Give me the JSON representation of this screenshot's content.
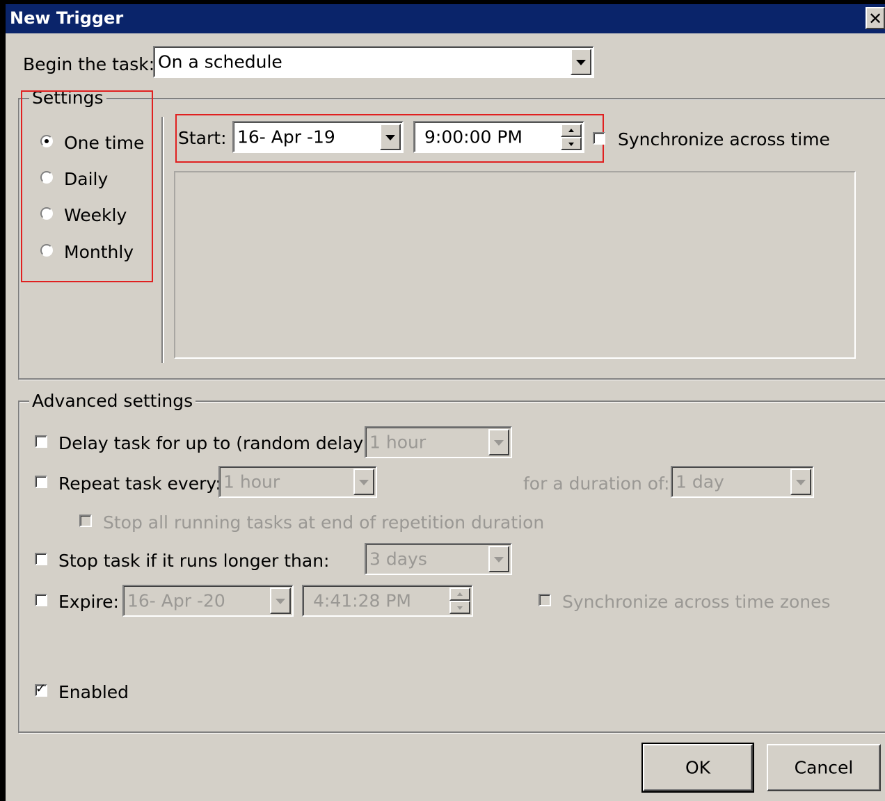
{
  "window": {
    "title": "New Trigger",
    "close_label": "✕"
  },
  "begin": {
    "label": "Begin the task:",
    "value": "On a schedule"
  },
  "settings": {
    "legend": "Settings",
    "options": [
      {
        "label": "One time",
        "selected": true
      },
      {
        "label": "Daily",
        "selected": false
      },
      {
        "label": "Weekly",
        "selected": false
      },
      {
        "label": "Monthly",
        "selected": false
      }
    ],
    "start_label": "Start:",
    "start_date": "16- Apr -19",
    "start_time": "9:00:00 PM",
    "sync_label": "Synchronize across time",
    "sync_checked": false
  },
  "advanced": {
    "legend": "Advanced settings",
    "delay": {
      "label": "Delay task for up to (random delay):",
      "value": "1 hour",
      "checked": false
    },
    "repeat": {
      "label": "Repeat task every:",
      "value": "1 hour",
      "checked": false,
      "duration_label": "for a duration of:",
      "duration_value": "1 day"
    },
    "stop_all": {
      "label": "Stop all running tasks at end of repetition duration",
      "checked": false
    },
    "stop_longer": {
      "label": "Stop task if it runs longer than:",
      "value": "3 days",
      "checked": false
    },
    "expire": {
      "label": "Expire:",
      "date": "16- Apr -20",
      "time": "4:41:28 PM",
      "checked": false,
      "sync_label": "Synchronize across time zones"
    },
    "enabled": {
      "label": "Enabled",
      "checked": true
    }
  },
  "buttons": {
    "ok": "OK",
    "cancel": "Cancel"
  },
  "colors": {
    "title_bar": "#0a246a",
    "dialog_face": "#d4d0c8",
    "highlight_box": "#e02020",
    "disabled_text": "#9a9894"
  }
}
